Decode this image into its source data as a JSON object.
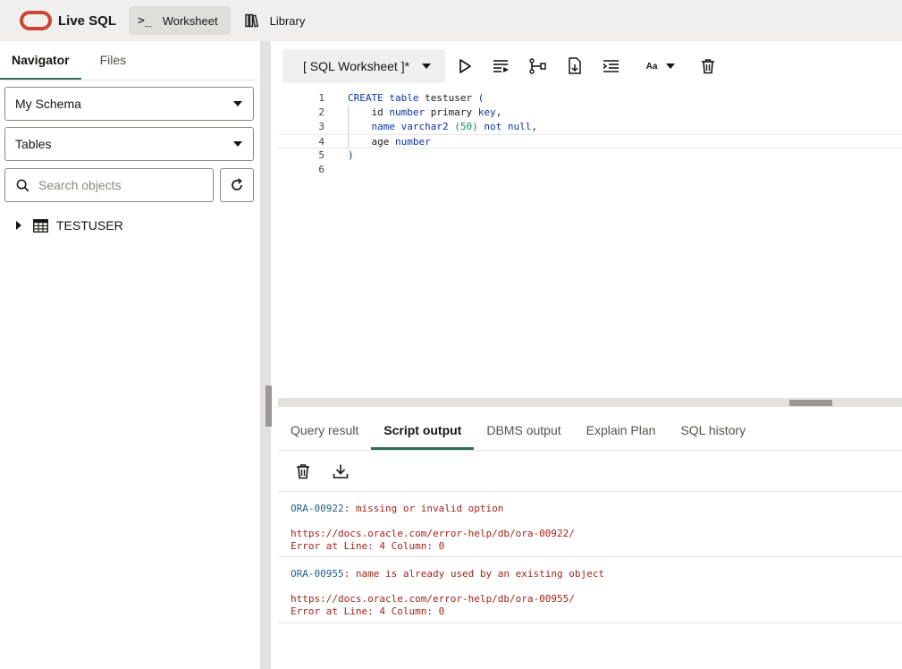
{
  "header": {
    "app_name": "Live SQL",
    "nav": [
      {
        "label": "Worksheet",
        "icon": "terminal-icon",
        "active": true
      },
      {
        "label": "Library",
        "icon": "books-icon",
        "active": false
      }
    ]
  },
  "navigator": {
    "tabs": [
      {
        "label": "Navigator",
        "active": true
      },
      {
        "label": "Files",
        "active": false
      }
    ],
    "schema_select": "My Schema",
    "object_type_select": "Tables",
    "search_placeholder": "Search objects",
    "tree": [
      {
        "label": "TESTUSER",
        "icon": "table-icon"
      }
    ]
  },
  "editor": {
    "tab_label": "[ SQL Worksheet ]*",
    "toolbar_icons": [
      "run-statement-icon",
      "run-script-icon",
      "explain-plan-icon",
      "autotrace-icon",
      "format-icon",
      "font-size-icon",
      "clear-icon"
    ],
    "font_button_label": "Aa",
    "line_numbers": [
      "1",
      "2",
      "3",
      "4",
      "5",
      "6"
    ],
    "current_line": 4,
    "lines": [
      [
        {
          "t": "kw",
          "v": "CREATE table "
        },
        {
          "t": "plain",
          "v": "testuser "
        },
        {
          "t": "kw",
          "v": "("
        }
      ],
      [
        {
          "t": "plain",
          "v": "    id "
        },
        {
          "t": "kw",
          "v": "number "
        },
        {
          "t": "plain",
          "v": "primary "
        },
        {
          "t": "kw",
          "v": "key"
        },
        {
          "t": "plain",
          "v": ","
        }
      ],
      [
        {
          "t": "kw",
          "v": "    name varchar2 "
        },
        {
          "t": "num",
          "v": "(50) "
        },
        {
          "t": "kw",
          "v": "not null"
        },
        {
          "t": "plain",
          "v": ","
        }
      ],
      [
        {
          "t": "plain",
          "v": "    age "
        },
        {
          "t": "kw",
          "v": "number"
        }
      ],
      [
        {
          "t": "kw",
          "v": ")"
        }
      ],
      []
    ]
  },
  "output": {
    "tabs": [
      {
        "label": "Query result",
        "active": false
      },
      {
        "label": "Script output",
        "active": true
      },
      {
        "label": "DBMS output",
        "active": false
      },
      {
        "label": "Explain Plan",
        "active": false
      },
      {
        "label": "SQL history",
        "active": false
      }
    ],
    "messages": [
      {
        "code": "ORA-00922",
        "text": ": missing or invalid option",
        "url": "https://docs.oracle.com/error-help/db/ora-00922/",
        "location": "Error at Line: 4 Column: 0"
      },
      {
        "code": "ORA-00955",
        "text": ": name is already used by an existing object",
        "url": "https://docs.oracle.com/error-help/db/ora-00955/",
        "location": "Error at Line: 4 Column: 0"
      }
    ]
  },
  "colors": {
    "brand": "#c74634",
    "accent": "#2f6b5a",
    "keyword": "#0b33a8",
    "number": "#148a5a",
    "error_code": "#1f5f8c",
    "error_text": "#a3231a"
  }
}
